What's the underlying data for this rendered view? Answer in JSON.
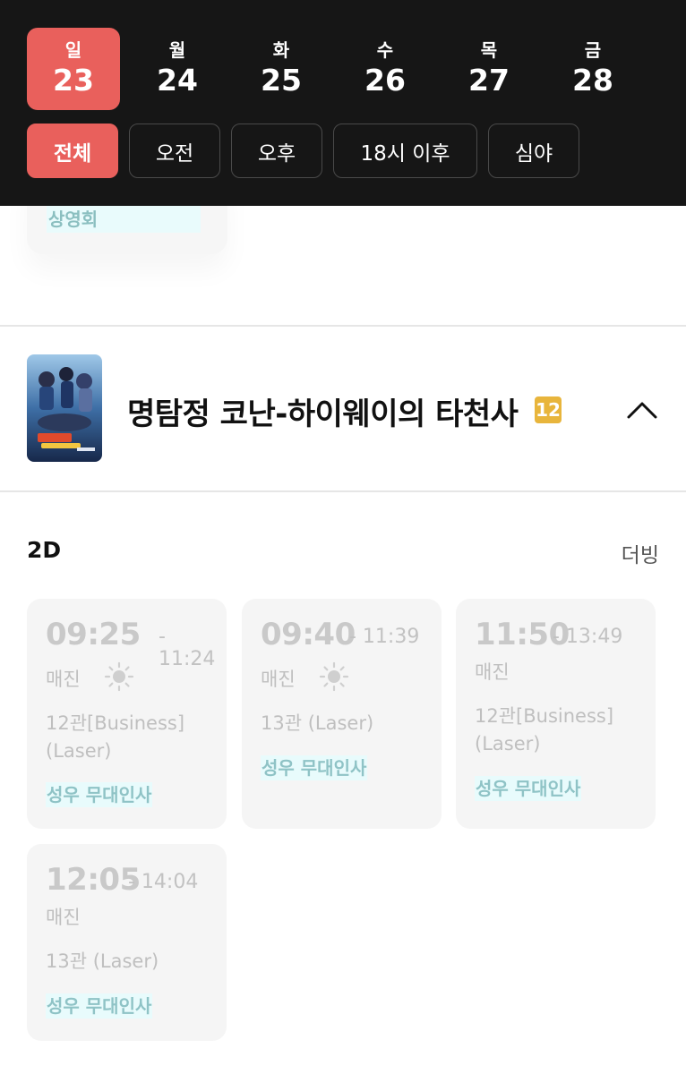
{
  "dates": [
    {
      "dow": "일",
      "num": "23",
      "active": true
    },
    {
      "dow": "월",
      "num": "24",
      "active": false
    },
    {
      "dow": "화",
      "num": "25",
      "active": false
    },
    {
      "dow": "수",
      "num": "26",
      "active": false
    },
    {
      "dow": "목",
      "num": "27",
      "active": false
    },
    {
      "dow": "금",
      "num": "28",
      "active": false
    }
  ],
  "filters": [
    "전체",
    "오전",
    "오후",
    "18시 이후",
    "심야"
  ],
  "prev_card": {
    "note": "상영회"
  },
  "movie": {
    "title": "명탐정 코난-하이웨이의 타천사",
    "rating": "12"
  },
  "format": {
    "label": "2D",
    "audio": "더빙"
  },
  "showtimes": [
    {
      "start": "09:25",
      "end": "- 11:24",
      "status": "매진",
      "hall": "12관[Business] (Laser)",
      "tag": "성우 무대인사",
      "sun": true
    },
    {
      "start": "09:40",
      "end": "- 11:39",
      "status": "매진",
      "hall": "13관 (Laser)",
      "tag": "성우 무대인사",
      "sun": true
    },
    {
      "start": "11:50",
      "end": "- 13:49",
      "status": "매진",
      "hall": "12관[Business] (Laser)",
      "tag": "성우 무대인사",
      "sun": false
    },
    {
      "start": "12:05",
      "end": "- 14:04",
      "status": "매진",
      "hall": "13관 (Laser)",
      "tag": "성우 무대인사",
      "sun": false
    }
  ],
  "colors": {
    "accent": "#e9605c",
    "header_bg": "#161616",
    "rating_badge": "#e8b53c",
    "tag_bg": "#e8fbfc"
  }
}
